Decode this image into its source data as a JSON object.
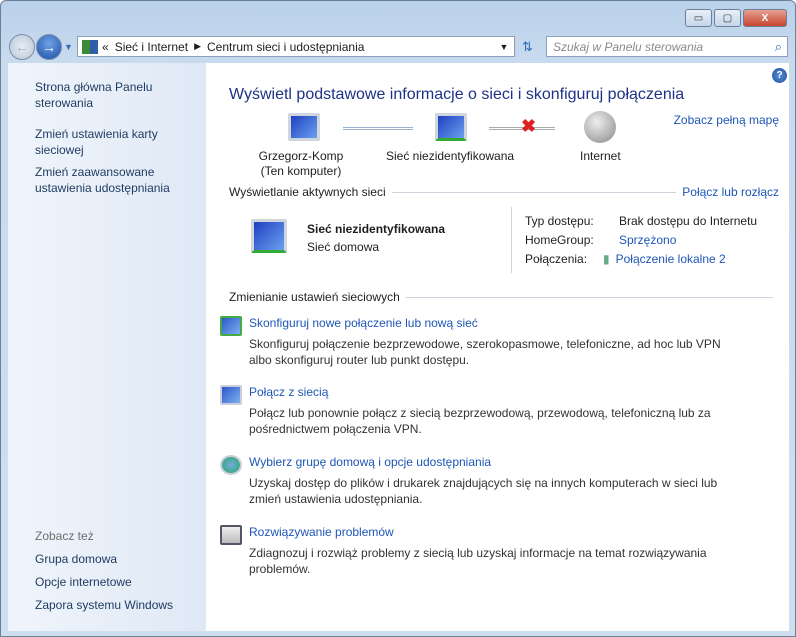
{
  "window": {
    "minimize": "▭",
    "maximize": "▢",
    "close": "X"
  },
  "address": {
    "prefix": "«",
    "crumbs": [
      "Sieć i Internet",
      "Centrum sieci i udostępniania"
    ]
  },
  "search": {
    "placeholder": "Szukaj w Panelu sterowania"
  },
  "sidebar": {
    "items": [
      "Strona główna Panelu sterowania",
      "Zmień ustawienia karty sieciowej",
      "Zmień zaawansowane ustawienia udostępniania"
    ],
    "see_also_label": "Zobacz też",
    "see_also": [
      "Grupa domowa",
      "Opcje internetowe",
      "Zapora systemu Windows"
    ]
  },
  "main": {
    "title": "Wyświetl podstawowe informacje o sieci i skonfiguruj połączenia",
    "full_map": "Zobacz pełną mapę",
    "map": {
      "computer": "Grzegorz-Komp",
      "computer_sub": "(Ten komputer)",
      "network": "Sieć niezidentyfikowana",
      "internet": "Internet"
    },
    "active_header": "Wyświetlanie aktywnych sieci",
    "connect_disconnect": "Połącz lub rozłącz",
    "active": {
      "name": "Sieć niezidentyfikowana",
      "type": "Sieć domowa",
      "access_label": "Typ dostępu:",
      "access_value": "Brak dostępu do Internetu",
      "homegroup_label": "HomeGroup:",
      "homegroup_value": "Sprzężono",
      "connections_label": "Połączenia:",
      "connections_value": "Połączenie lokalne 2"
    },
    "change_header": "Zmienianie ustawień sieciowych",
    "tasks": [
      {
        "title": "Skonfiguruj nowe połączenie lub nową sieć",
        "desc": "Skonfiguruj połączenie bezprzewodowe, szerokopasmowe, telefoniczne, ad hoc lub VPN albo skonfiguruj router lub punkt dostępu."
      },
      {
        "title": "Połącz z siecią",
        "desc": "Połącz lub ponownie połącz z siecią bezprzewodową, przewodową, telefoniczną lub za pośrednictwem połączenia VPN."
      },
      {
        "title": "Wybierz grupę domową i opcje udostępniania",
        "desc": "Uzyskaj dostęp do plików i drukarek znajdujących się na innych komputerach w sieci lub zmień ustawienia udostępniania."
      },
      {
        "title": "Rozwiązywanie problemów",
        "desc": "Zdiagnozuj i rozwiąż problemy z siecią lub uzyskaj informacje na temat rozwiązywania problemów."
      }
    ]
  }
}
